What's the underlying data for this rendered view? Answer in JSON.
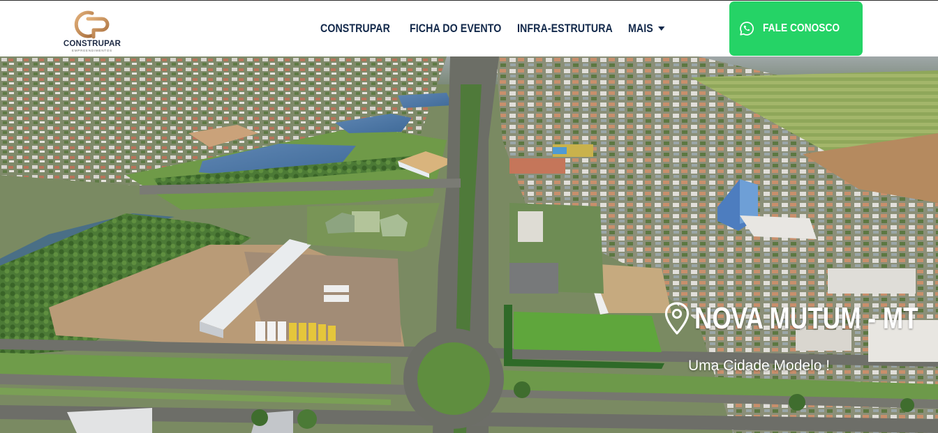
{
  "brand": {
    "name": "CONSTRUPAR",
    "subtitle": "EMPREENDIMENTOS",
    "colors": {
      "gold": "#c9925a",
      "navy": "#13294b"
    }
  },
  "nav": {
    "items": [
      {
        "label": "CONSTRUPAR"
      },
      {
        "label": "FICHA DO EVENTO"
      },
      {
        "label": "INFRA-ESTRUTURA"
      },
      {
        "label": "MAIS",
        "icon": "caret-down-icon"
      }
    ]
  },
  "cta": {
    "label": "FALE CONOSCO",
    "icon": "whatsapp-icon",
    "color": "#25d366"
  },
  "hero": {
    "title": "NOVA MUTUM - MT",
    "tagline": "Uma Cidade Modelo !",
    "icon": "location-pin-icon",
    "image": "aerial-city-photo"
  }
}
